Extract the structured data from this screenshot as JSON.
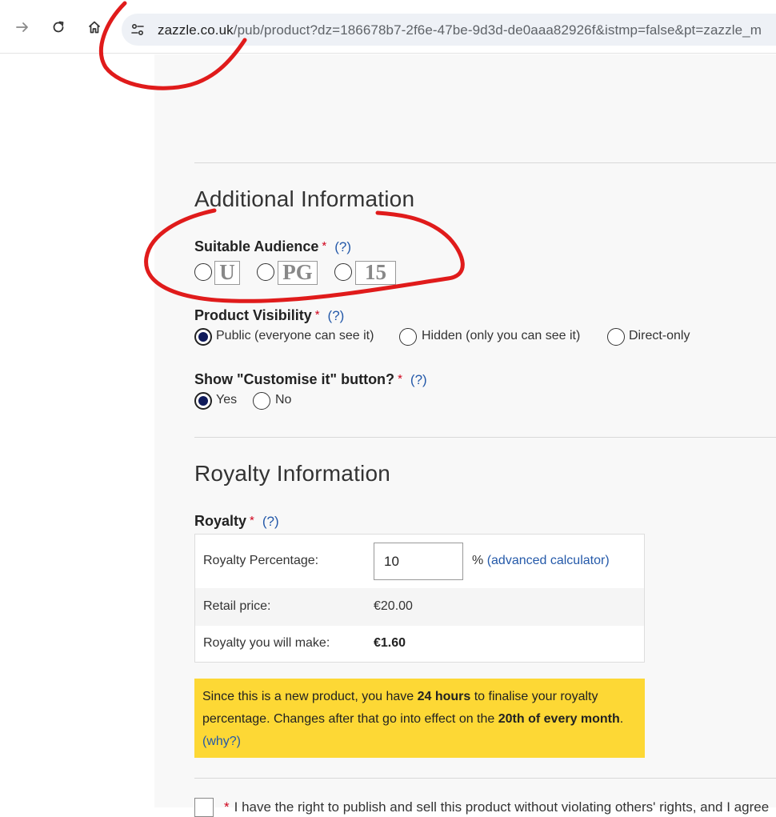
{
  "browser": {
    "url_domain": "zazzle.co.uk",
    "url_path": "/pub/product?dz=186678b7-2f6e-47be-9d3d-de0aaa82926f&istmp=false&pt=zazzle_m"
  },
  "additional_info": {
    "title": "Additional Information",
    "audience": {
      "label": "Suitable Audience",
      "required": "*",
      "help": "(?)",
      "ratings": [
        "U",
        "PG",
        "15"
      ]
    },
    "visibility": {
      "label": "Product Visibility",
      "required": "*",
      "help": "(?)",
      "options": [
        "Public (everyone can see it)",
        "Hidden (only you can see it)",
        "Direct-only"
      ],
      "selected": "Public (everyone can see it)"
    },
    "customise": {
      "label": "Show \"Customise it\" button?",
      "required": "*",
      "help": "(?)",
      "options": [
        "Yes",
        "No"
      ],
      "selected": "Yes"
    }
  },
  "royalty_info": {
    "title": "Royalty Information",
    "label": "Royalty",
    "required": "*",
    "help": "(?)",
    "percentage_label": "Royalty Percentage:",
    "percentage_value": "10",
    "percent_sign": "%",
    "calculator_link": "(advanced calculator)",
    "retail_label": "Retail price:",
    "retail_value": "€20.00",
    "make_label": "Royalty you will make:",
    "make_value": "€1.60"
  },
  "notice": {
    "t1": "Since this is a new product, you have ",
    "b1": "24 hours",
    "t2": " to finalise your royalty percentage. Changes after that go into effect on the ",
    "b2": "20th of every month",
    "t3": ". ",
    "why": "(why?)"
  },
  "legal": {
    "required": "*",
    "text": "I have the right to publish and sell this product without violating others' rights, and I agree"
  },
  "colors": {
    "notice_bg": "#fdd835",
    "link": "#2459a9",
    "required": "#d0021b",
    "annotation": "#e01b1b"
  }
}
